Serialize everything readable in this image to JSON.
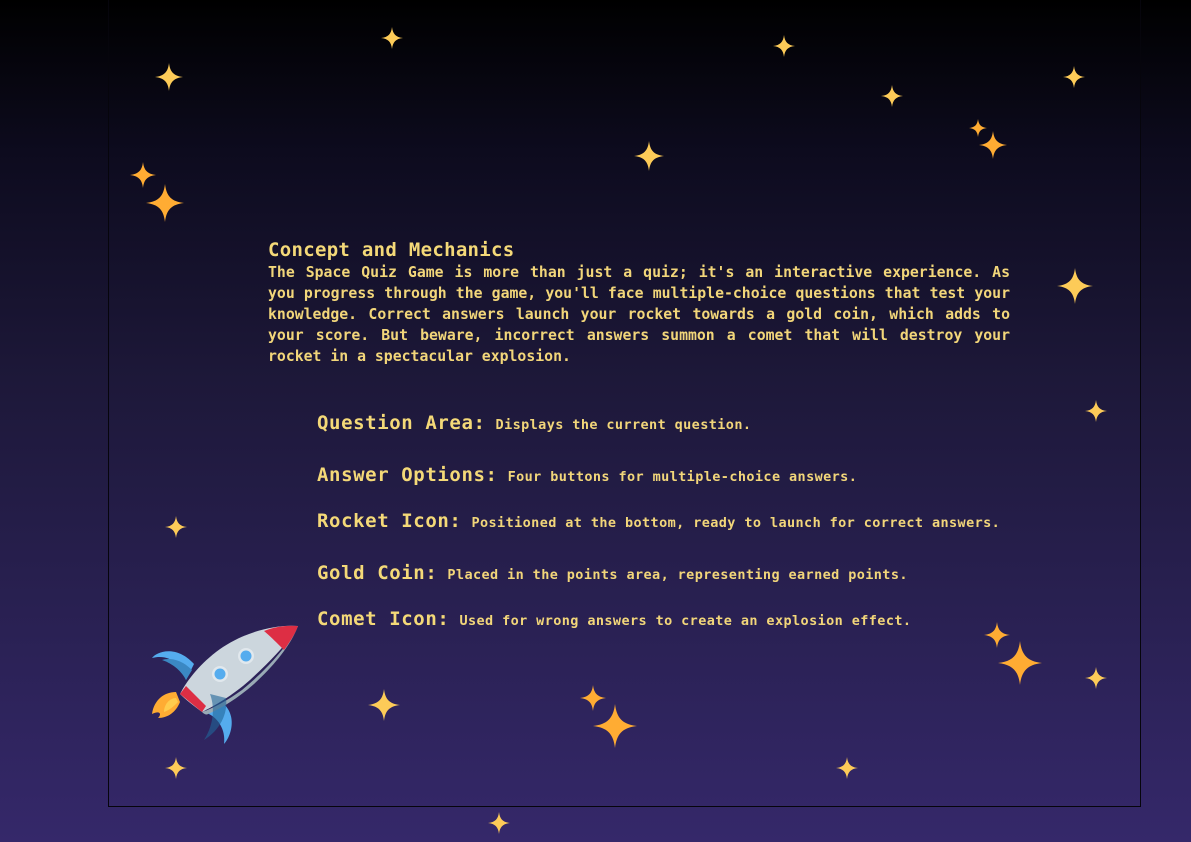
{
  "concept": {
    "title": "Concept and Mechanics",
    "body": "The Space Quiz Game is more than just a quiz; it's an interactive experience. As you progress through the game, you'll face multiple-choice questions that test your knowledge. Correct answers launch your rocket towards a gold coin, which adds to your score. But beware, incorrect answers summon a comet that will destroy your rocket in a spectacular explosion."
  },
  "features": [
    {
      "label": "Question Area:",
      "desc": "Displays the current question."
    },
    {
      "label": "Answer Options:",
      "desc": "Four buttons for multiple-choice answers."
    },
    {
      "label": "Rocket Icon:",
      "desc": "Positioned at the bottom, ready to launch for correct answers."
    },
    {
      "label": "Gold Coin:",
      "desc": "Placed in the points area, representing earned points."
    },
    {
      "label": "Comet Icon:",
      "desc": "Used for wrong answers to create an explosion effect."
    }
  ],
  "icons": {
    "rocket": "rocket-icon",
    "star": "sparkle-star-icon"
  },
  "colors": {
    "text": "#f2d67a",
    "star_yellow": "#fdcb58",
    "star_orange": "#ffac33",
    "rocket_red": "#dd2e44",
    "rocket_blue": "#55acee"
  }
}
